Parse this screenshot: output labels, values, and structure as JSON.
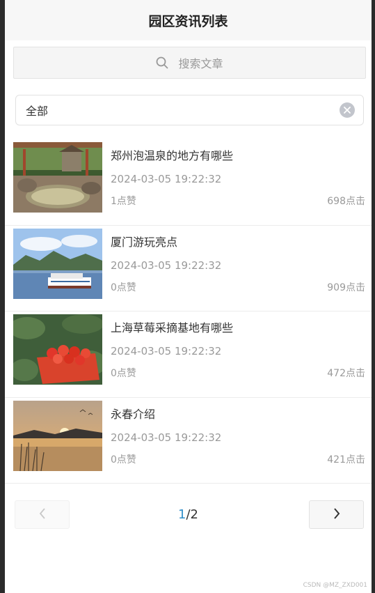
{
  "header": {
    "title": "园区资讯列表"
  },
  "search": {
    "placeholder": "搜索文章",
    "icon": "search-icon"
  },
  "filter": {
    "selected": "全部",
    "clear_icon": "clear-icon"
  },
  "articles": [
    {
      "title": "郑州泡温泉的地方有哪些",
      "time": "2024-03-05 19:22:32",
      "likes": "1点赞",
      "clicks": "698点击",
      "image": "hot-spring-photo"
    },
    {
      "title": "厦门游玩亮点",
      "time": "2024-03-05 19:22:32",
      "likes": "0点赞",
      "clicks": "909点击",
      "image": "ferry-photo"
    },
    {
      "title": "上海草莓采摘基地有哪些",
      "time": "2024-03-05 19:22:32",
      "likes": "0点赞",
      "clicks": "472点击",
      "image": "strawberry-photo"
    },
    {
      "title": "永春介绍",
      "time": "2024-03-05 19:22:32",
      "likes": "0点赞",
      "clicks": "421点击",
      "image": "sunset-lake-photo"
    }
  ],
  "pagination": {
    "current": "1",
    "separator": "/",
    "total": "2",
    "prev_icon": "chevron-left-icon",
    "next_icon": "chevron-right-icon"
  },
  "watermark": "CSDN @MZ_ZXD001",
  "colors": {
    "accent": "#2f8ec9",
    "muted": "#999999",
    "title": "#222222"
  }
}
